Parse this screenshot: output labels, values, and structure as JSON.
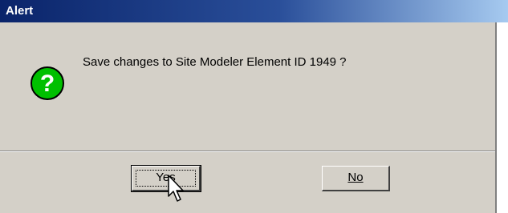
{
  "window": {
    "title": "Alert"
  },
  "dialog": {
    "message": "Save changes to Site Modeler Element ID 1949 ?",
    "icon": "question-icon",
    "icon_color": "#00c000"
  },
  "buttons": {
    "yes_label": "Yes",
    "no_label": "No"
  }
}
